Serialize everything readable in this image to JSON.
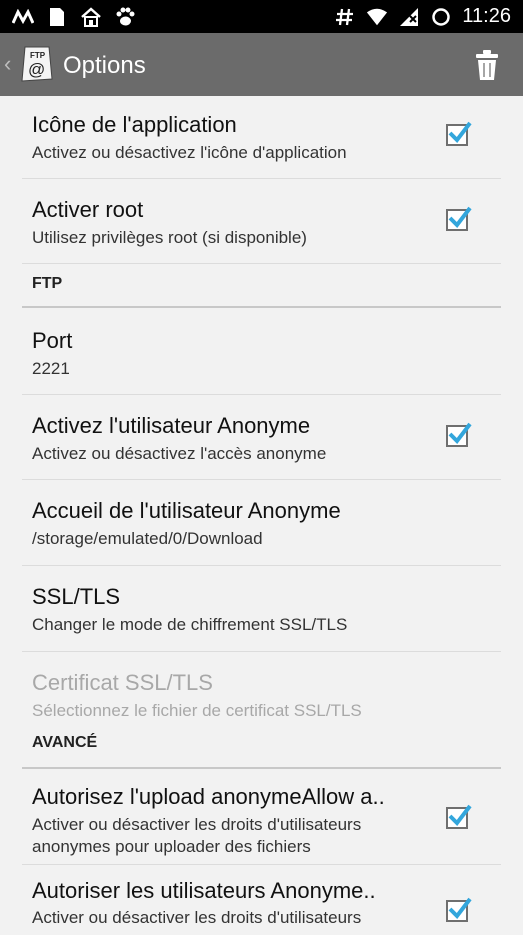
{
  "status_bar": {
    "left_icons": [
      "m-logo-icon",
      "document-icon",
      "house-icon",
      "paw-icon"
    ],
    "right_icons": [
      "hash-icon",
      "wifi-icon",
      "signal-icon",
      "sync-icon"
    ],
    "time": "11:26"
  },
  "action_bar": {
    "title": "Options",
    "app_icon_label": "FTP",
    "app_icon_symbol": "@"
  },
  "items": [
    {
      "title": "Icône de l'application",
      "subtitle": "Activez ou désactivez l'icône d'application",
      "checked": true
    },
    {
      "title": "Activer root",
      "subtitle": "Utilisez privilèges root (si disponible)",
      "checked": true
    }
  ],
  "sections": {
    "ftp": "FTP",
    "advanced": "AVANCÉ"
  },
  "ftp_items": [
    {
      "title": "Port",
      "subtitle": "2221"
    },
    {
      "title": "Activez l'utilisateur Anonyme",
      "subtitle": "Activez ou désactivez l'accès anonyme",
      "checked": true
    },
    {
      "title": "Accueil de l'utilisateur Anonyme",
      "subtitle": "/storage/emulated/0/Download"
    },
    {
      "title": "SSL/TLS",
      "subtitle": "Changer le mode de chiffrement SSL/TLS"
    },
    {
      "title": "Certificat SSL/TLS",
      "subtitle": "Sélectionnez le fichier de certificat SSL/TLS",
      "disabled": true
    }
  ],
  "advanced_items": [
    {
      "title": "Autorisez l'upload anonymeAllow a..",
      "subtitle_line1": "Activer ou désactiver les droits d'utilisateurs",
      "subtitle_line2": "anonymes pour uploader des fichiers",
      "checked": true
    },
    {
      "title": "Autoriser les utilisateurs Anonyme..",
      "subtitle_line1": "Activer ou désactiver les droits d'utilisateurs",
      "checked": true
    }
  ],
  "colors": {
    "action_bar": "#6b6b6b",
    "checkmark": "#33a6dc",
    "background": "#f2f2f2"
  }
}
